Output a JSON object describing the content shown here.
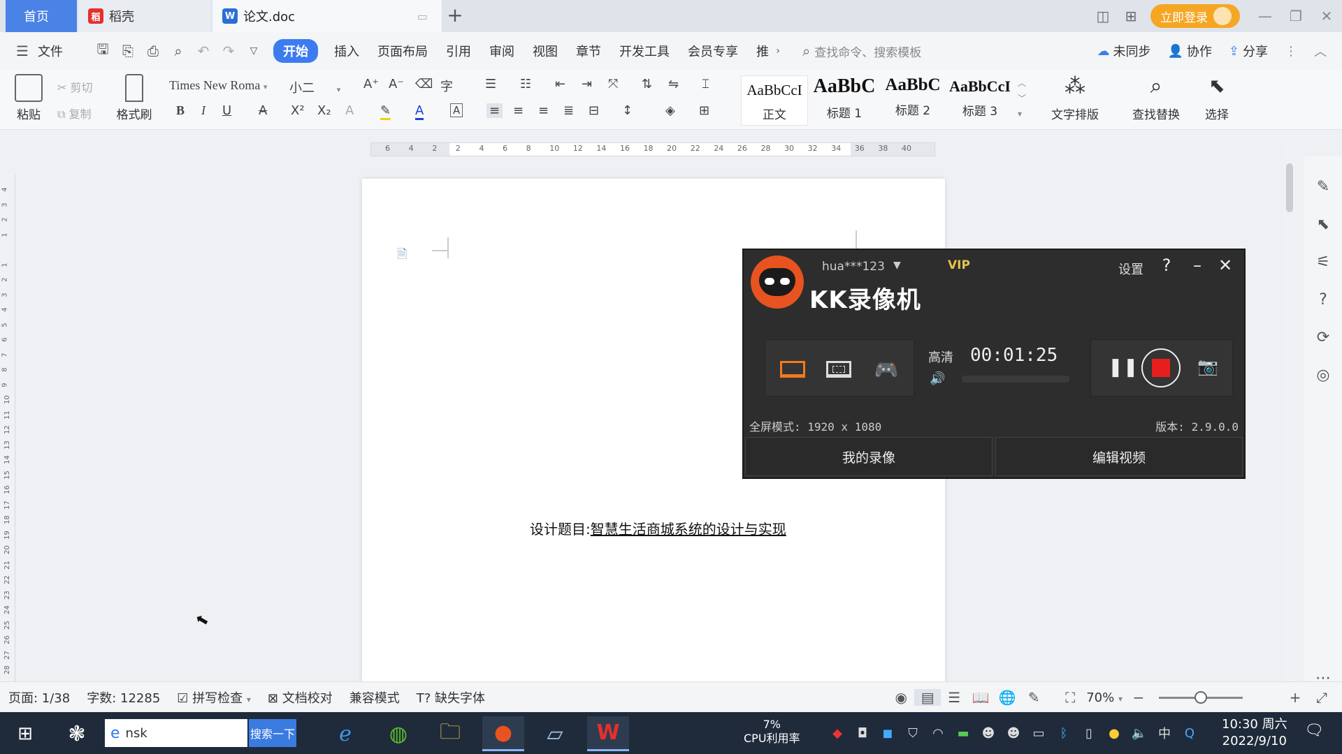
{
  "tabs": {
    "home": "首页",
    "docer": "稻壳",
    "doc": "论文.doc",
    "login": "立即登录"
  },
  "menu": {
    "file": "文件",
    "items": [
      "开始",
      "插入",
      "页面布局",
      "引用",
      "审阅",
      "视图",
      "章节",
      "开发工具",
      "会员专享",
      "推"
    ],
    "search_placeholder": "查找命令、搜索模板",
    "sync": "未同步",
    "collab": "协作",
    "share": "分享"
  },
  "ribbon": {
    "paste": "粘贴",
    "cut": "剪切",
    "copy": "复制",
    "format_painter": "格式刷",
    "font_name": "Times New Roma",
    "font_size": "小二",
    "styles": [
      {
        "sample": "AaBbCcI",
        "label": "正文"
      },
      {
        "sample": "AaBbC",
        "label": "标题 1"
      },
      {
        "sample": "AaBbC",
        "label": "标题 2"
      },
      {
        "sample": "AaBbCcI",
        "label": "标题 3"
      }
    ],
    "text_layout": "文字排版",
    "find_replace": "查找替换",
    "select": "选择"
  },
  "ruler": {
    "h_ticks": [
      "6",
      "4",
      "2",
      "2",
      "4",
      "6",
      "8",
      "10",
      "12",
      "14",
      "16",
      "18",
      "20",
      "22",
      "24",
      "26",
      "28",
      "30",
      "32",
      "34",
      "36",
      "38",
      "40"
    ]
  },
  "document": {
    "title_label": "设计题目:",
    "title_value": "智慧生活商城系统的设计与实现"
  },
  "recorder": {
    "user": "hua***123",
    "vip": "VIP",
    "title": "KK录像机",
    "settings": "设置",
    "quality": "高清",
    "timer": "00:01:25",
    "mode": "全屏模式: 1920 x 1080",
    "version": "版本: 2.9.0.0",
    "my_recordings": "我的录像",
    "edit_video": "编辑视频",
    "accent_color": "#e81e1e"
  },
  "status": {
    "page": "页面: 1/38",
    "words": "字数: 12285",
    "spellcheck": "拼写检查",
    "proofread": "文档校对",
    "compat": "兼容模式",
    "missing_font": "缺失字体",
    "zoom": "70%",
    "zoom_level_percent": 70
  },
  "taskbar": {
    "search_value": "nsk",
    "search_button": "搜索一下",
    "cpu_percent": "7%",
    "cpu_label": "CPU利用率",
    "time": "10:30 周六",
    "date": "2022/9/10",
    "ime": "中"
  },
  "colors": {
    "accent": "#3d7cf0",
    "tab_home": "#4a82e6",
    "login": "#f5a623"
  }
}
